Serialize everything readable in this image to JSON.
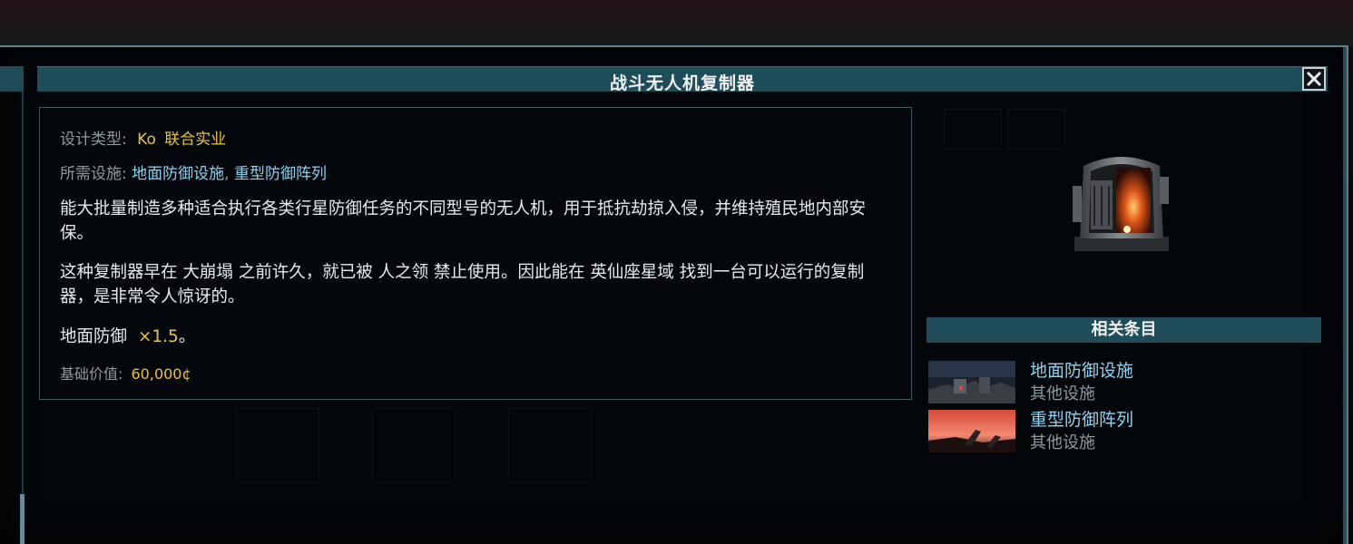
{
  "window": {
    "title": "战斗无人机复制器"
  },
  "details": {
    "design_type_label": "设计类型:",
    "design_type_prefix": "Ko",
    "design_type_value": "联合实业",
    "required_label": "所需设施:",
    "required_1": "地面防御设施",
    "required_sep": ",",
    "required_2": "重型防御阵列",
    "paragraph_1": "能大批量制造多种适合执行各类行星防御任务的不同型号的无人机，用于抵抗劫掠入侵，并维持殖民地内部安保。",
    "paragraph_2": "这种复制器早在 大崩塌 之前许久，就已被 人之领 禁止使用。因此能在 英仙座星域 找到一台可以运行的复制器，是非常令人惊讶的。",
    "bonus_label": "地面防御",
    "bonus_value": "×1.5",
    "bonus_end": "。",
    "base_value_label": "基础价值:",
    "base_value": "60,000¢"
  },
  "related": {
    "header": "相关条目",
    "items": [
      {
        "name": "地面防御设施",
        "category": "其他设施"
      },
      {
        "name": "重型防御阵列",
        "category": "其他设施"
      }
    ]
  },
  "colors": {
    "accent_bar": "#1f4d5a",
    "gold_text": "#e6c24a",
    "link_text": "#8fd2f0"
  },
  "icons": {
    "close": "close-icon",
    "portrait": "drone-replicator-portrait"
  }
}
